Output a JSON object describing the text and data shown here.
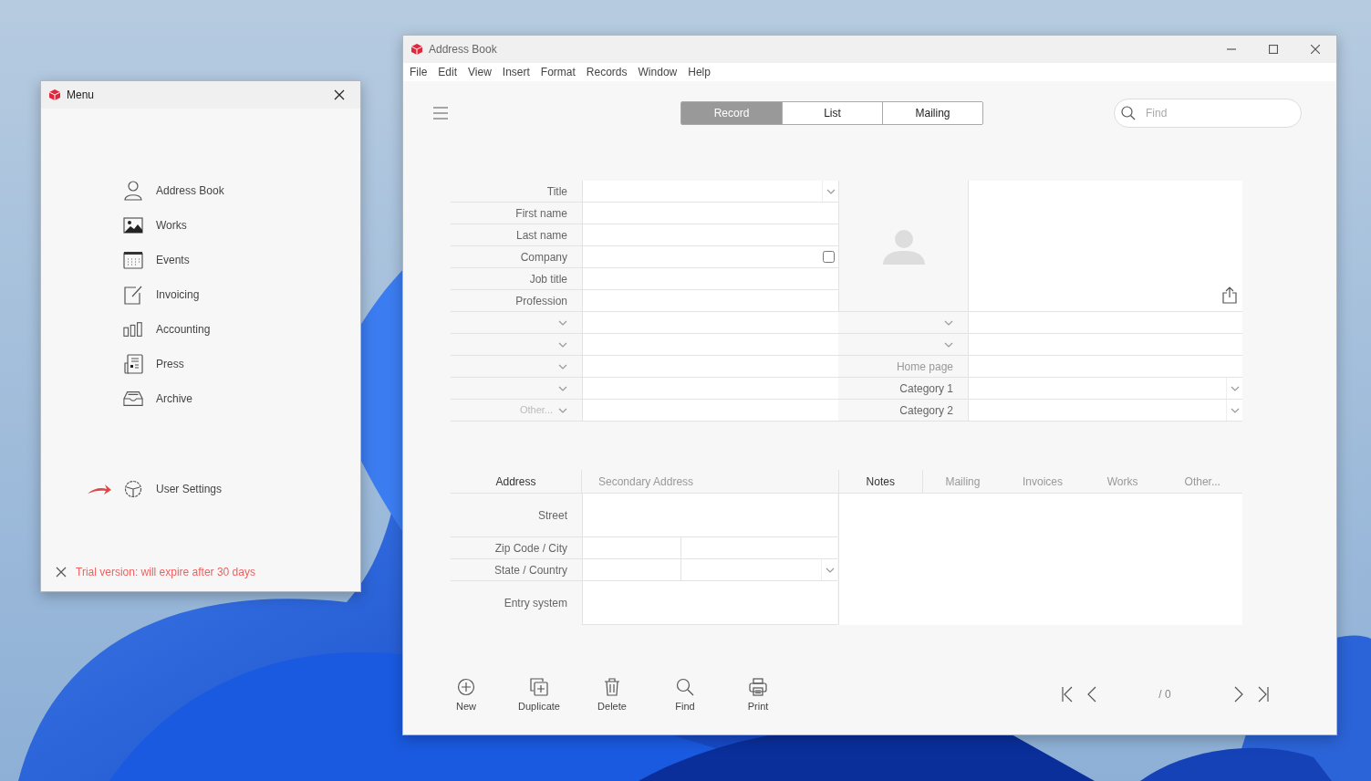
{
  "menu_window": {
    "title": "Menu",
    "items": [
      {
        "label": "Address Book"
      },
      {
        "label": "Works"
      },
      {
        "label": "Events"
      },
      {
        "label": "Invoicing"
      },
      {
        "label": "Accounting"
      },
      {
        "label": "Press"
      },
      {
        "label": "Archive"
      }
    ],
    "settings_item": {
      "label": "User Settings"
    },
    "trial_notice": "Trial version: will expire after 30 days"
  },
  "main_window": {
    "title": "Address Book",
    "menu": [
      "File",
      "Edit",
      "View",
      "Insert",
      "Format",
      "Records",
      "Window",
      "Help"
    ],
    "view_tabs": [
      {
        "label": "Record",
        "selected": true
      },
      {
        "label": "List",
        "selected": false
      },
      {
        "label": "Mailing",
        "selected": false
      }
    ],
    "search": {
      "placeholder": "Find"
    },
    "left_fields": [
      {
        "label": "Title",
        "kind": "select"
      },
      {
        "label": "First name",
        "kind": "text"
      },
      {
        "label": "Last name",
        "kind": "text"
      },
      {
        "label": "Company",
        "kind": "checkbox",
        "checked": false
      },
      {
        "label": "Job title",
        "kind": "text"
      },
      {
        "label": "Profession",
        "kind": "text"
      },
      {
        "kind": "label-select"
      },
      {
        "kind": "label-select"
      },
      {
        "kind": "label-select"
      },
      {
        "kind": "label-select"
      },
      {
        "label": "Other...",
        "kind": "label-select"
      }
    ],
    "right_fields": [
      {
        "kind": "label-select"
      },
      {
        "kind": "label-select"
      },
      {
        "label": "Home page",
        "kind": "url"
      },
      {
        "label": "Category 1",
        "kind": "select"
      },
      {
        "label": "Category 2",
        "kind": "select"
      }
    ],
    "address_tabs": [
      {
        "label": "Address",
        "selected": true
      },
      {
        "label": "Secondary Address",
        "selected": false
      }
    ],
    "address_fields": [
      {
        "label": "Street",
        "kind": "tall"
      },
      {
        "label": "Zip Code / City",
        "kind": "split"
      },
      {
        "label": "State / Country",
        "kind": "split-select"
      },
      {
        "label": "Entry system",
        "kind": "tall"
      }
    ],
    "notes_tabs": [
      {
        "label": "Notes",
        "selected": true
      },
      {
        "label": "Mailing",
        "selected": false
      },
      {
        "label": "Invoices",
        "selected": false
      },
      {
        "label": "Works",
        "selected": false
      },
      {
        "label": "Other...",
        "selected": false
      }
    ],
    "actions": [
      {
        "label": "New"
      },
      {
        "label": "Duplicate"
      },
      {
        "label": "Delete"
      },
      {
        "label": "Find"
      },
      {
        "label": "Print"
      }
    ],
    "record_counter": "/ 0"
  }
}
